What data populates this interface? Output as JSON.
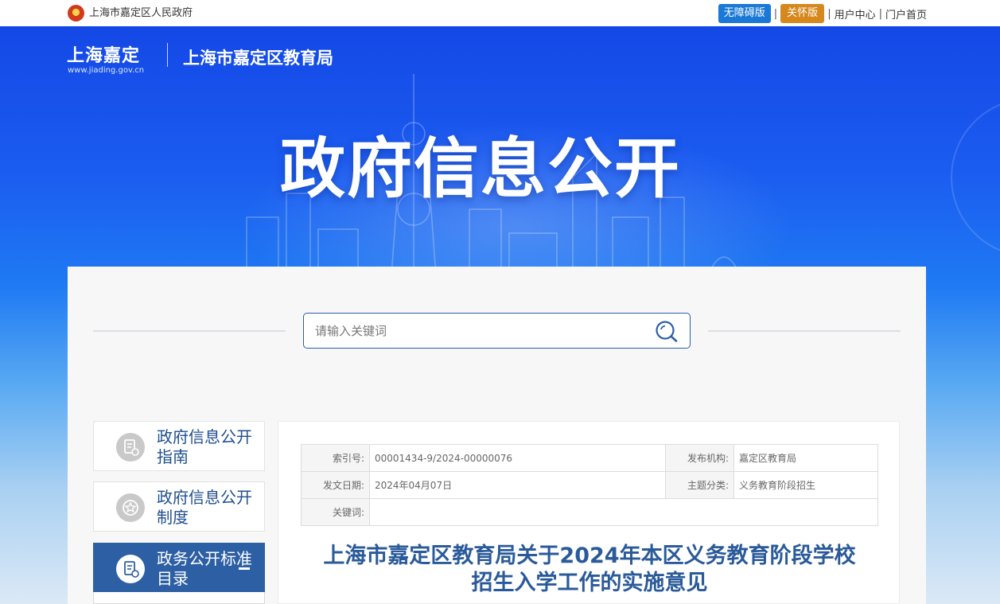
{
  "topbar": {
    "gov_name": "上海市嘉定区人民政府",
    "accessible_label": "无障碍版",
    "care_label": "关怀版",
    "separator": "|",
    "user_center": "用户中心",
    "portal_home": "门户首页"
  },
  "header": {
    "logo_text": "上海嘉定",
    "logo_url": "www.jiading.gov.cn",
    "bureau_name": "上海市嘉定区教育局",
    "hero_title": "政府信息公开"
  },
  "search": {
    "placeholder": "请输入关键词",
    "icon": "search-icon"
  },
  "sidebar": {
    "items": [
      {
        "label": "政府信息公开指南",
        "icon": "guide-doc-icon"
      },
      {
        "label": "政府信息公开制度",
        "icon": "star-badge-icon"
      },
      {
        "label": "政务公开标准目录",
        "icon": "catalog-doc-icon",
        "active": true,
        "toggle_icon": "minus-icon"
      }
    ]
  },
  "document": {
    "meta": {
      "index_label": "索引号:",
      "index_value": "00001434-9/2024-00000076",
      "issuer_label": "发布机构:",
      "issuer_value": "嘉定区教育局",
      "date_label": "发文日期:",
      "date_value": "2024年04月07日",
      "topic_label": "主题分类:",
      "topic_value": "义务教育阶段招生",
      "keywords_label": "关键词:",
      "keywords_value": ""
    },
    "title_line1": "上海市嘉定区教育局关于2024年本区义务教育阶段学校",
    "title_line2": "招生入学工作的实施意见"
  },
  "colors": {
    "accessible_btn": "#1a78d6",
    "care_btn": "#d6881d",
    "sidebar_active": "#2c5fa3",
    "title_text": "#2a5a9a"
  }
}
